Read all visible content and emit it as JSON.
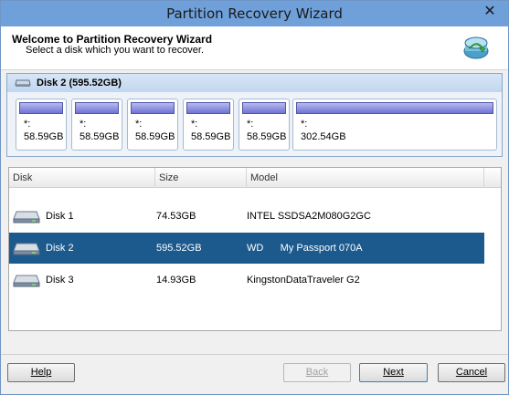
{
  "window": {
    "title": "Partition Recovery Wizard",
    "close_glyph": "✕"
  },
  "header": {
    "title": "Welcome to Partition Recovery Wizard",
    "subtitle": "Select a disk which you want to recover.",
    "icon": "recovery-wizard-icon"
  },
  "disk_panel": {
    "label": "Disk 2 (595.52GB)",
    "icon": "disk-icon",
    "partitions": [
      {
        "name": "*:",
        "size": "58.59GB"
      },
      {
        "name": "*:",
        "size": "58.59GB"
      },
      {
        "name": "*:",
        "size": "58.59GB"
      },
      {
        "name": "*:",
        "size": "58.59GB"
      },
      {
        "name": "*:",
        "size": "58.59GB"
      },
      {
        "name": "*:",
        "size": "302.54GB"
      }
    ]
  },
  "disk_list": {
    "columns": [
      "Disk",
      "Size",
      "Model"
    ],
    "rows": [
      {
        "disk": "Disk 1",
        "size": "74.53GB",
        "model": "INTEL SSDSA2M080G2GC",
        "selected": false
      },
      {
        "disk": "Disk 2",
        "size": "595.52GB",
        "model": "WD      My Passport 070A",
        "selected": true
      },
      {
        "disk": "Disk 3",
        "size": "14.93GB",
        "model": "KingstonDataTraveler G2",
        "selected": false
      }
    ]
  },
  "buttons": {
    "help": "Help",
    "back": "Back",
    "next": "Next",
    "cancel": "Cancel"
  },
  "colors": {
    "titlebar": "#6fa0da",
    "selection": "#1c5a8e",
    "partition_bar": "#6f73d4"
  }
}
